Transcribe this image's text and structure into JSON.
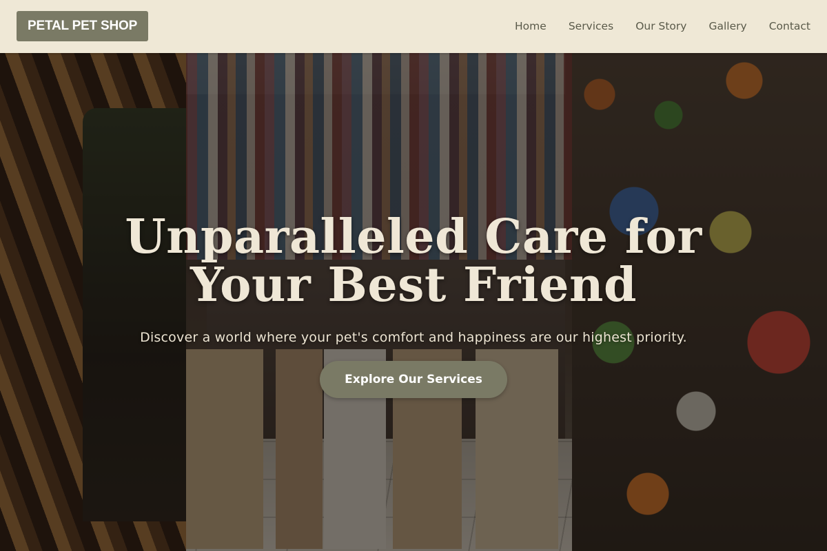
{
  "header": {
    "logo": "PETAL PET SHOP",
    "nav": [
      {
        "label": "Home"
      },
      {
        "label": "Services"
      },
      {
        "label": "Our Story"
      },
      {
        "label": "Gallery"
      },
      {
        "label": "Contact"
      }
    ]
  },
  "hero": {
    "headline_line1": "Unparalleled Care for",
    "headline_line2": "Your Best Friend",
    "subtitle": "Discover a world where your pet's comfort and happiness are our highest priority.",
    "cta_label": "Explore Our Services"
  },
  "colors": {
    "header_bg": "#efe8d6",
    "accent": "#7a7a65",
    "nav_text": "#5a5a4a",
    "hero_text": "#efe7d6"
  }
}
